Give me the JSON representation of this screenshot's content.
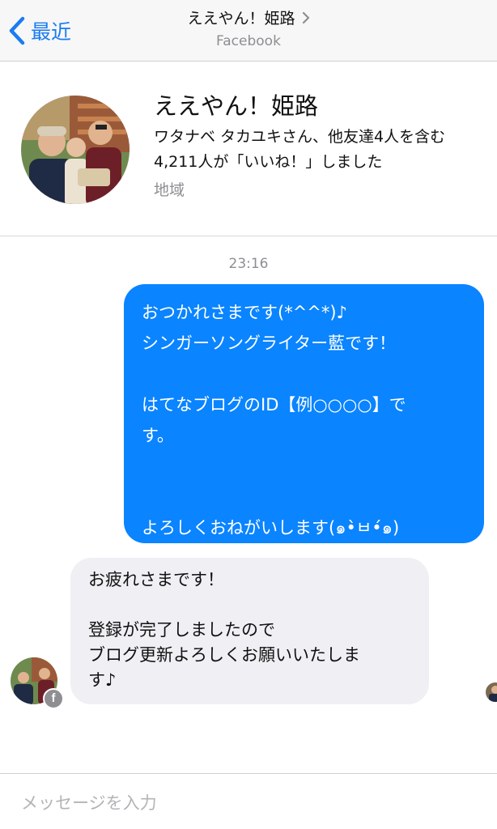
{
  "nav": {
    "back_label": "最近",
    "title": "ええやん！姫路",
    "subtitle": "Facebook",
    "accent": "#1a7cf2"
  },
  "profile": {
    "name": "ええやん！姫路",
    "description_lines": [
      "ワタナベ タカユキさん、他友達4人を含む",
      "4,211人が「いいね！」しました"
    ],
    "category": "地域"
  },
  "conversation": {
    "timestamp": "23:16",
    "outgoing": {
      "color": "#0a84ff",
      "lines": [
        "おつかれさまです(*^^*)♪",
        "シンガーソングライター藍です！",
        "",
        "はてなブログのID【例○○○○】で",
        "す。",
        "",
        "",
        "よろしくおねがいします(๑•̀ㅂ•́๑)"
      ]
    },
    "incoming": {
      "color": "#efeff4",
      "lines": [
        "お疲れさまです！",
        "",
        "登録が完了しましたので",
        "ブログ更新よろしくお願いいたしま",
        "す♪"
      ]
    }
  },
  "icons": {
    "back": "chevron-left-icon",
    "title_disclosure": "chevron-right-icon",
    "sender_badge": "facebook-icon"
  },
  "composer": {
    "placeholder": "メッセージを入力",
    "value": ""
  }
}
